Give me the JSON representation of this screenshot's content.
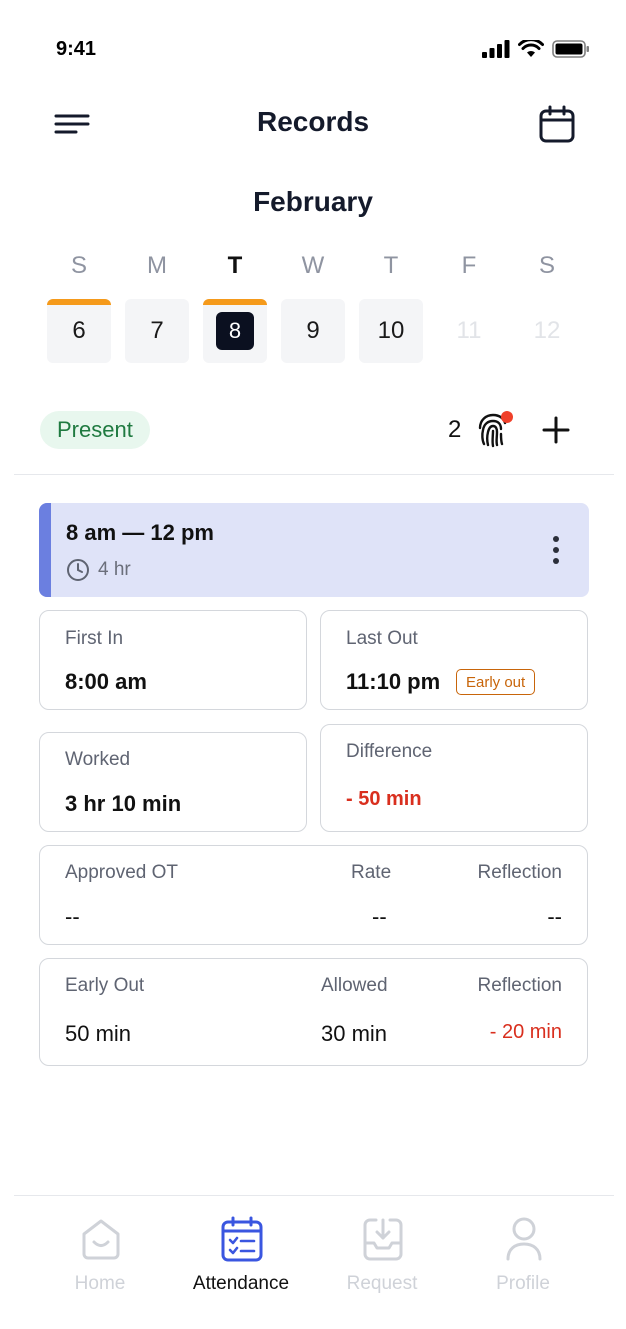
{
  "status_bar": {
    "time": "9:41"
  },
  "header": {
    "title": "Records"
  },
  "calendar": {
    "month": "February",
    "weekdays": [
      "S",
      "M",
      "T",
      "W",
      "T",
      "F",
      "S"
    ],
    "days": [
      "6",
      "7",
      "8",
      "9",
      "10",
      "11",
      "12"
    ],
    "selected_day": "8"
  },
  "day_status": {
    "badge": "Present",
    "punch_count": "2"
  },
  "shift": {
    "time_range": "8 am — 12 pm",
    "duration": "4 hr"
  },
  "first_in": {
    "label": "First In",
    "value": "8:00 am"
  },
  "last_out": {
    "label": "Last Out",
    "value": "11:10 pm",
    "badge": "Early out"
  },
  "worked": {
    "label": "Worked",
    "value": "3 hr 10 min"
  },
  "difference": {
    "label": "Difference",
    "value": "- 50 min"
  },
  "approved_ot": {
    "label": "Approved OT",
    "rate_label": "Rate",
    "reflection_label": "Reflection",
    "value": "--",
    "rate_value": "--",
    "reflection_value": "--"
  },
  "early_out": {
    "label": "Early Out",
    "allowed_label": "Allowed",
    "reflection_label": "Reflection",
    "value": "50 min",
    "allowed_value": "30 min",
    "reflection_value": "- 20 min"
  },
  "tabbar": {
    "items": [
      {
        "label": "Home",
        "icon": "home-icon"
      },
      {
        "label": "Attendance",
        "icon": "attendance-icon"
      },
      {
        "label": "Request",
        "icon": "inbox-download-icon"
      },
      {
        "label": "Profile",
        "icon": "profile-icon"
      }
    ],
    "active": "Attendance"
  },
  "colors": {
    "accent_blue": "#3a56e0",
    "present_green": "#1f7a40",
    "late_orange": "#f59a1b",
    "negative_red": "#d92f1e",
    "shift_bg": "#dfe3f8"
  }
}
